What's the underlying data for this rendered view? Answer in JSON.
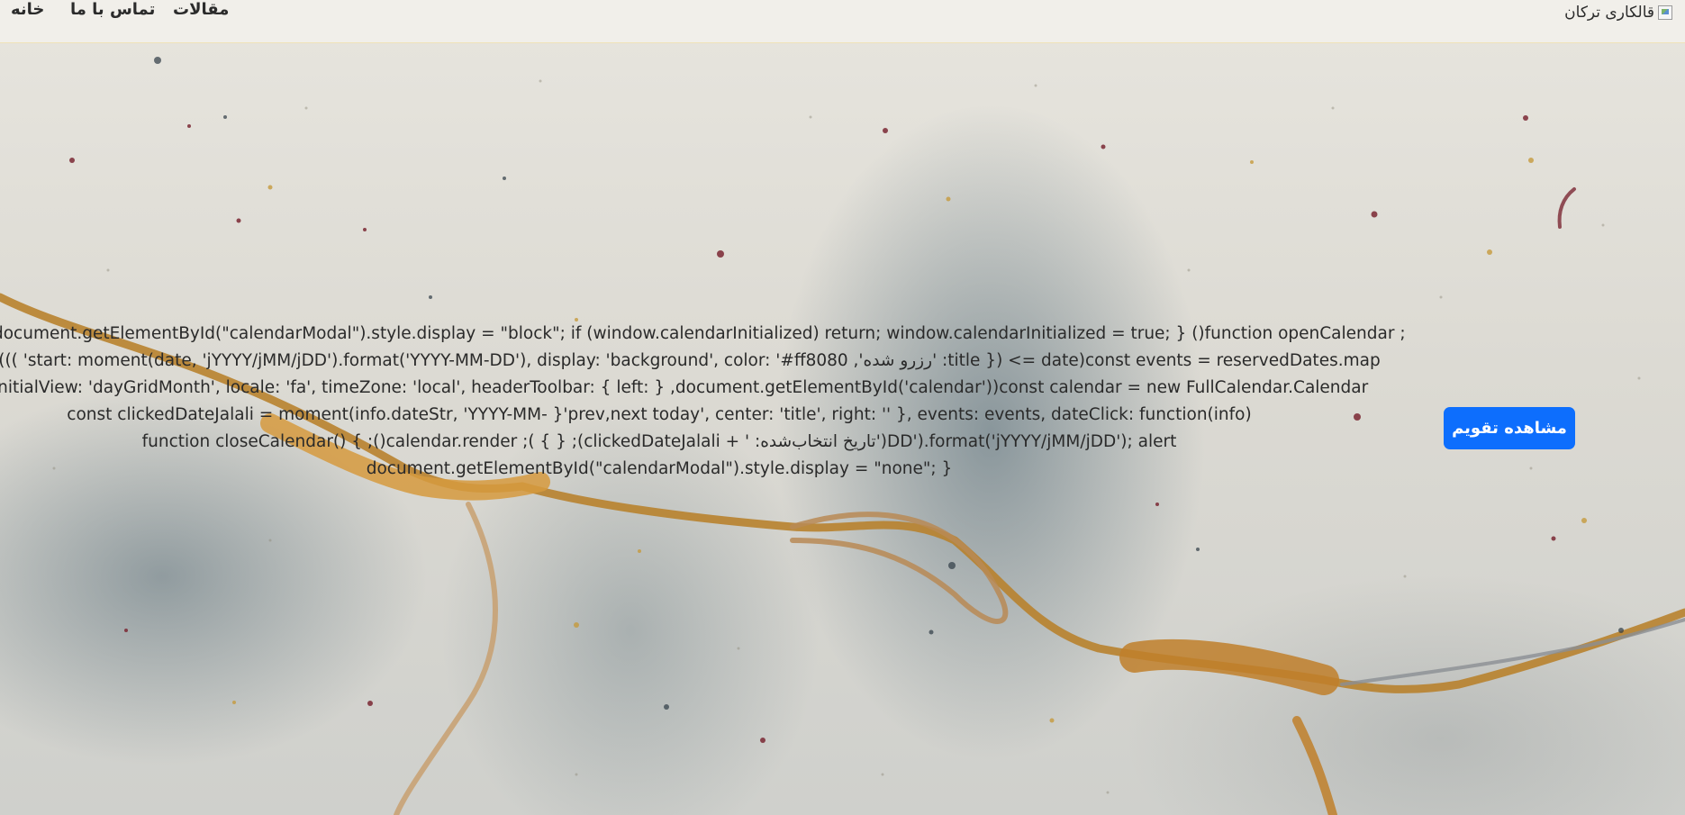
{
  "navbar": {
    "brand_text": "قالکاری ترکان",
    "brand_logo_icon": "broken-image-icon",
    "links": [
      {
        "label": "خانه"
      },
      {
        "label": "تماس با ما"
      },
      {
        "label": "مقالات"
      }
    ]
  },
  "hero": {
    "background_icon": "gold-marble-vein-image",
    "code_lines": [
      "document.getElementById(\"calendarModal\").style.display = \"block\"; if (window.calendarInitialized) return; window.calendarInitialized = true; } ()function openCalendar ;",
      ";((( 'start: moment(date, 'jYYYY/jMM/jDD').format('YYYY-MM-DD'), display: 'background', color: '#ff8080 ,'رزرو شده' :title }) <= date)const events = reservedDates.map",
      "initialView: 'dayGridMonth', locale: 'fa', timeZone: 'local', headerToolbar: { left: } ,document.getElementById('calendar'))const calendar = new FullCalendar.Calendar",
      "const clickedDateJalali = moment(info.dateStr, 'YYYY-MM- }'prev,next today', center: 'title', right: '' }, events: events, dateClick: function(info)",
      "function closeCalendar() { ;()calendar.render ;( { } ;(clickedDateJalali + ' :تاریخ انتخاب‌شده')DD').format('jYYYY/jMM/jDD'); alert",
      "document.getElementById(\"calendarModal\").style.display = \"none\"; }"
    ],
    "cta_label": "مشاهده تقویم"
  },
  "colors": {
    "cta": "#0d6efd",
    "navbar_bg": "#f2f0ea",
    "text": "#2a2a2a"
  }
}
